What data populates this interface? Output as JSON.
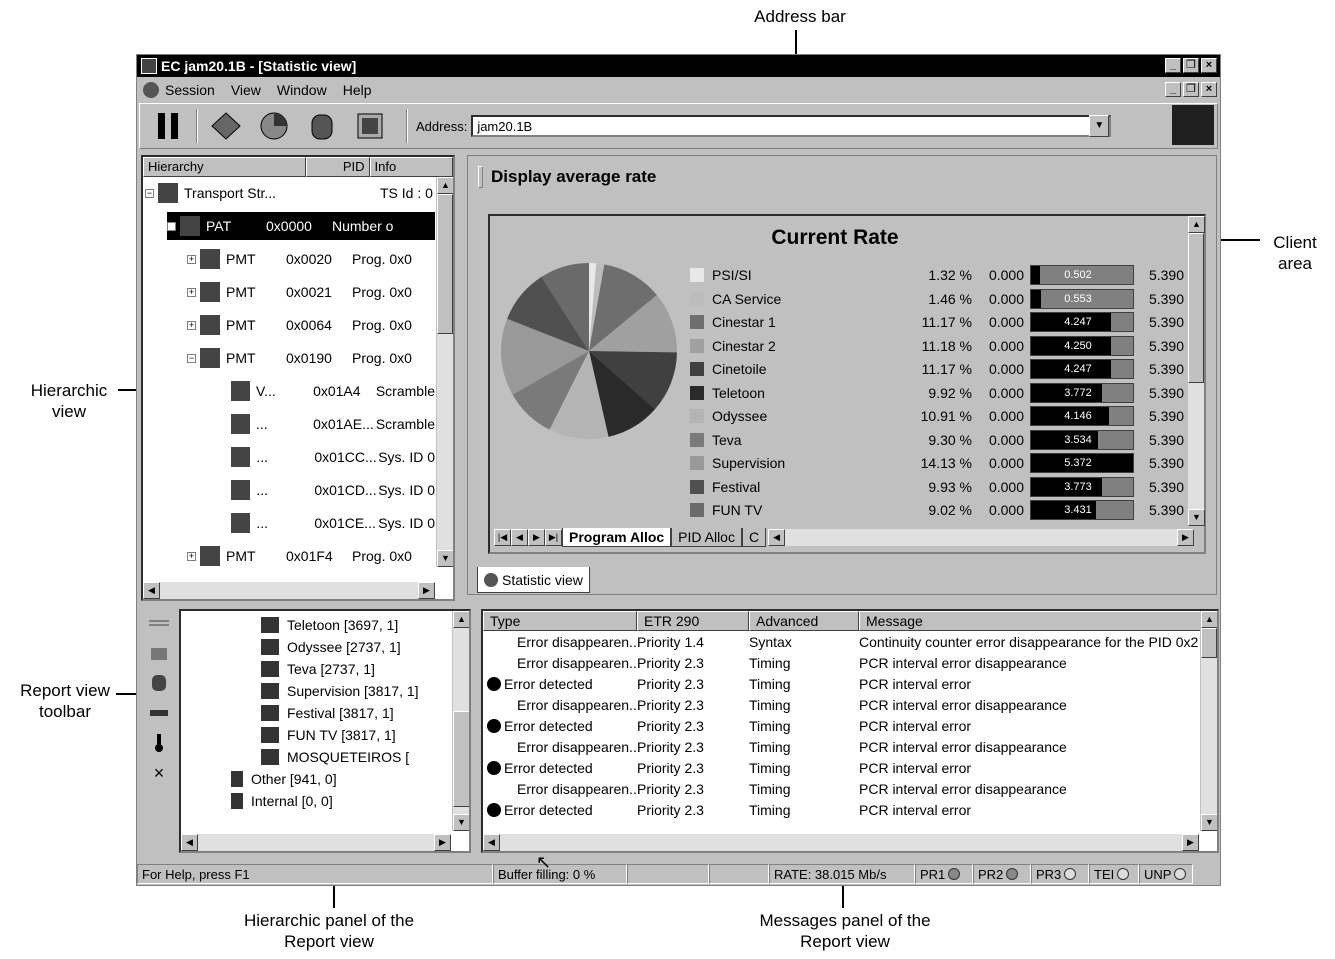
{
  "callouts": {
    "address_bar": "Address bar",
    "client_area": "Client area",
    "hierarchic_view": "Hierarchic view",
    "report_view_toolbar": "Report view toolbar",
    "hierarchic_panel": "Hierarchic panel of the Report view",
    "messages_panel": "Messages panel of the Report view"
  },
  "window": {
    "title": "EC jam20.1B - [Statistic view]",
    "min": "_",
    "restore": "❐",
    "close": "×"
  },
  "menu": [
    "Session",
    "View",
    "Window",
    "Help"
  ],
  "address": {
    "label": "Address:",
    "value": "jam20.1B",
    "dropdown": "▼"
  },
  "hierarchy": {
    "headers": [
      "Hierarchy",
      "PID",
      "Info"
    ],
    "rows": [
      {
        "name": "Transport Str...",
        "pid": "",
        "info": "TS Id : 0"
      },
      {
        "name": "PAT",
        "pid": "0x0000",
        "info": "Number o"
      },
      {
        "name": "PMT",
        "pid": "0x0020",
        "info": "Prog. 0x0"
      },
      {
        "name": "PMT",
        "pid": "0x0021",
        "info": "Prog. 0x0"
      },
      {
        "name": "PMT",
        "pid": "0x0064",
        "info": "Prog. 0x0"
      },
      {
        "name": "PMT",
        "pid": "0x0190",
        "info": "Prog. 0x0"
      },
      {
        "name": "V...",
        "pid": "0x01A4",
        "info": "Scramble"
      },
      {
        "name": "...",
        "pid": "0x01AE...",
        "info": "Scramble"
      },
      {
        "name": "...",
        "pid": "0x01CC...",
        "info": "Sys. ID 0"
      },
      {
        "name": "...",
        "pid": "0x01CD...",
        "info": "Sys. ID 0"
      },
      {
        "name": "...",
        "pid": "0x01CE...",
        "info": "Sys. ID 0"
      },
      {
        "name": "PMT",
        "pid": "0x01F4",
        "info": "Prog. 0x0"
      }
    ]
  },
  "client": {
    "header": "Display average rate",
    "chart_title": "Current Rate",
    "tabs": [
      "Program Alloc",
      "PID Alloc",
      "C"
    ],
    "doc_tab": "Statistic view"
  },
  "chart_data": {
    "type": "pie",
    "title": "Current Rate",
    "categories": [
      "PSI/SI",
      "CA Service",
      "Cinestar 1",
      "Cinestar 2",
      "Cinetoile",
      "Teletoon",
      "Odyssee",
      "Teva",
      "Supervision",
      "Festival",
      "FUN TV"
    ],
    "values": [
      1.32,
      1.46,
      11.17,
      11.18,
      11.17,
      9.92,
      10.91,
      9.3,
      14.13,
      9.93,
      9.02
    ],
    "percent_labels": [
      "1.32 %",
      "1.46 %",
      "11.17 %",
      "11.18 %",
      "11.17 %",
      "9.92 %",
      "10.91 %",
      "9.30 %",
      "14.13 %",
      "9.93 %",
      "9.02 %"
    ],
    "min": [
      "0.000",
      "0.000",
      "0.000",
      "0.000",
      "0.000",
      "0.000",
      "0.000",
      "0.000",
      "0.000",
      "0.000",
      "0.000"
    ],
    "current": [
      "0.502",
      "0.553",
      "4.247",
      "4.250",
      "4.247",
      "3.772",
      "4.146",
      "3.534",
      "5.372",
      "3.773",
      "3.431"
    ],
    "current_values": [
      0.502,
      0.553,
      4.247,
      4.25,
      4.247,
      3.772,
      4.146,
      3.534,
      5.372,
      3.773,
      3.431
    ],
    "max": [
      "5.390",
      "5.390",
      "5.390",
      "5.390",
      "5.390",
      "5.390",
      "5.390",
      "5.390",
      "5.390",
      "5.390",
      "5.390"
    ],
    "max_value": 5.39,
    "colors": [
      "#e8e8e8",
      "#bcbcbc",
      "#6e6e6e",
      "#a0a0a0",
      "#404040",
      "#2a2a2a",
      "#b4b4b4",
      "#7a7a7a",
      "#999999",
      "#505050",
      "#6a6a6a"
    ]
  },
  "report_tree": [
    {
      "label": "Teletoon  [3697, 1]"
    },
    {
      "label": "Odyssee  [2737, 1]"
    },
    {
      "label": "Teva  [2737, 1]"
    },
    {
      "label": "Supervision  [3817, 1]"
    },
    {
      "label": "Festival  [3817, 1]"
    },
    {
      "label": "FUN TV  [3817, 1]"
    },
    {
      "label": "MOSQUETEIROS  ["
    },
    {
      "label": "Other  [941, 0]"
    },
    {
      "label": "Internal  [0, 0]"
    }
  ],
  "messages": {
    "headers": [
      "Type",
      "ETR 290",
      "Advanced",
      "Message"
    ],
    "rows": [
      {
        "type": "Error disappearen...",
        "etr": "Priority 1.4",
        "adv": "Syntax",
        "msg": "Continuity counter error disappearance for the PID 0x2",
        "icon": false
      },
      {
        "type": "Error disappearen...",
        "etr": "Priority 2.3",
        "adv": "Timing",
        "msg": "PCR interval error disappearance",
        "icon": false
      },
      {
        "type": "Error detected",
        "etr": "Priority 2.3",
        "adv": "Timing",
        "msg": "PCR interval error",
        "icon": true
      },
      {
        "type": "Error disappearen...",
        "etr": "Priority 2.3",
        "adv": "Timing",
        "msg": "PCR interval error disappearance",
        "icon": false
      },
      {
        "type": "Error detected",
        "etr": "Priority 2.3",
        "adv": "Timing",
        "msg": "PCR interval error",
        "icon": true
      },
      {
        "type": "Error disappearen...",
        "etr": "Priority 2.3",
        "adv": "Timing",
        "msg": "PCR interval error disappearance",
        "icon": false
      },
      {
        "type": "Error detected",
        "etr": "Priority 2.3",
        "adv": "Timing",
        "msg": "PCR interval error",
        "icon": true
      },
      {
        "type": "Error disappearen...",
        "etr": "Priority 2.3",
        "adv": "Timing",
        "msg": "PCR interval error disappearance",
        "icon": false
      },
      {
        "type": "Error detected",
        "etr": "Priority 2.3",
        "adv": "Timing",
        "msg": "PCR interval error",
        "icon": true
      }
    ]
  },
  "status": {
    "help": "For Help, press F1",
    "buffer": "Buffer filling: 0 %",
    "buffer_fraction": 0,
    "rate": "RATE: 38.015 Mb/s",
    "leds": [
      "PR1",
      "PR2",
      "PR3",
      "TEI",
      "UNP"
    ]
  }
}
